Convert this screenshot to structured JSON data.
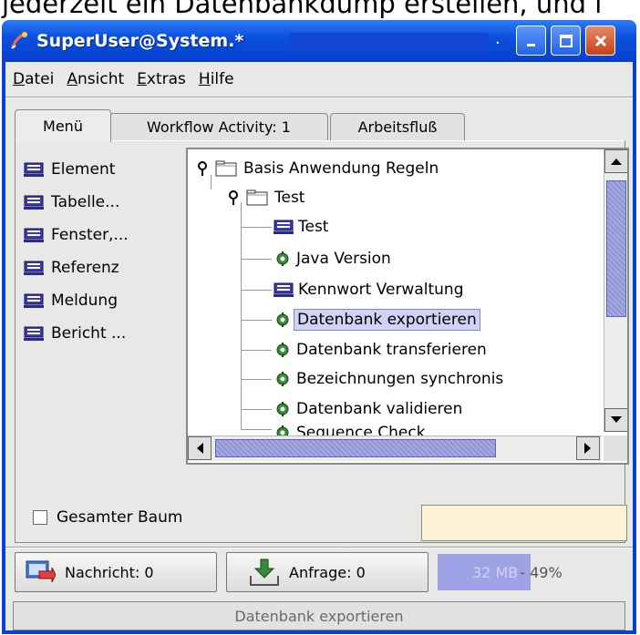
{
  "caption": "jederzeit ein Datenbankdump erstellen, und i",
  "window": {
    "title": "SuperUser@System.*",
    "title_suffix": "."
  },
  "menubar": {
    "items": [
      {
        "first": "D",
        "rest": "atei"
      },
      {
        "first": "A",
        "rest": "nsicht"
      },
      {
        "first": "E",
        "rest": "xtras"
      },
      {
        "first": "H",
        "rest": "ilfe"
      }
    ]
  },
  "tabs": [
    "Menü",
    "Workflow Activity: 1",
    "Arbeitsfluß"
  ],
  "left_list": [
    "Element",
    "Tabelle...",
    "Fenster,...",
    "Referenz",
    "Meldung",
    "Bericht ..."
  ],
  "tree": {
    "root": "Basis Anwendung Regeln",
    "folder": "Test",
    "items": [
      {
        "label": "Test",
        "icon": "monitor-icon"
      },
      {
        "label": "Java Version",
        "icon": "gear-icon"
      },
      {
        "label": "Kennwort Verwaltung",
        "icon": "monitor-icon"
      },
      {
        "label": "Datenbank exportieren",
        "icon": "gear-icon",
        "selected": true
      },
      {
        "label": "Datenbank transferieren",
        "icon": "gear-icon"
      },
      {
        "label": "Bezeichnungen synchronis",
        "icon": "gear-icon"
      },
      {
        "label": "Datenbank validieren",
        "icon": "gear-icon"
      },
      {
        "label": "Sequence Check",
        "icon": "gear-icon"
      }
    ]
  },
  "checkbox": {
    "label": "Gesamter Baum",
    "checked": false
  },
  "buttons": {
    "message": "Nachricht: 0",
    "request": "Anfrage: 0"
  },
  "memory": {
    "label": "32 MB",
    "percent_text": "- 49%",
    "usage_fraction": 0.49
  },
  "status": "Datenbank exportieren",
  "colors": {
    "titlebar": "#0b50de",
    "selection": "#cfd3f6",
    "memory_bar": "#a0a2e6",
    "field_bg": "#fff1d6"
  }
}
